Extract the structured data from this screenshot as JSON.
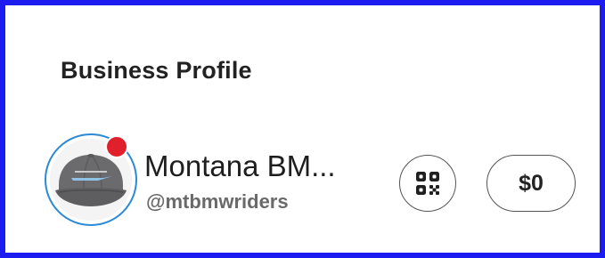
{
  "section": {
    "title": "Business Profile"
  },
  "profile": {
    "name": "Montana BM...",
    "handle": "@mtbmwriders",
    "has_notification": true
  },
  "actions": {
    "qr_icon": "qr-code-icon",
    "balance_label": "$0"
  },
  "colors": {
    "frame_border": "#1c1cf0",
    "avatar_ring": "#2b8ad6",
    "notification_dot": "#e0202a"
  }
}
